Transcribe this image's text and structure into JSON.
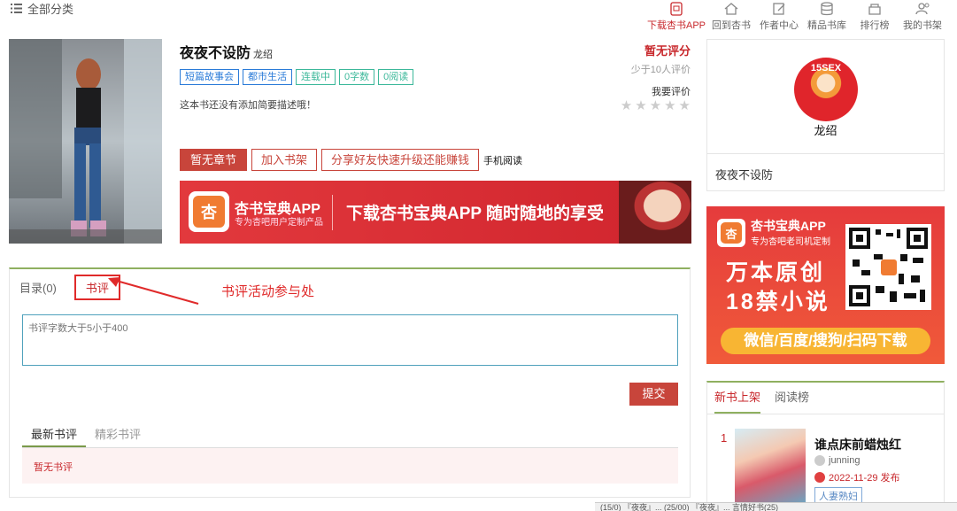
{
  "topbar": {
    "all_categories": "全部分类"
  },
  "nav": [
    {
      "label": "下载杏书APP",
      "icon": "phone-app-icon"
    },
    {
      "label": "回到杏书",
      "icon": "home-icon"
    },
    {
      "label": "作者中心",
      "icon": "edit-icon"
    },
    {
      "label": "精品书库",
      "icon": "database-icon"
    },
    {
      "label": "排行榜",
      "icon": "ranking-icon"
    },
    {
      "label": "我的书架",
      "icon": "user-icon"
    }
  ],
  "book": {
    "title": "夜夜不设防",
    "author": "龙绍",
    "tags": [
      "短篇故事会",
      "都市生活",
      "连载中",
      "0字数",
      "0阅读"
    ],
    "description": "这本书还没有添加简要描述哦！",
    "score": "暂无评分",
    "score_sub": "少于10人评价",
    "my_rate": "我要评价",
    "stars": [
      "★",
      "★",
      "★",
      "★",
      "★"
    ]
  },
  "actions": {
    "no_chapter": "暂无章节",
    "add_shelf": "加入书架",
    "share": "分享好友快速升级还能赚钱",
    "mobile_read": "手机阅读"
  },
  "banner": {
    "app_name": "杏书宝典APP",
    "app_sub": "专为杏吧用户定制产品",
    "slogan": "下载杏书宝典APP 随时随地的享受"
  },
  "tabs": {
    "directory": "目录(0)",
    "review": "书评"
  },
  "annotation": "书评活动参与处",
  "review_form": {
    "placeholder": "书评字数大于5小于400",
    "submit": "提交"
  },
  "review_tabs": [
    "最新书评",
    "精彩书评"
  ],
  "no_review": "暂无书评",
  "author_card": {
    "avatar_text": "15SEX",
    "name": "龙绍",
    "book": "夜夜不设防"
  },
  "side_banner": {
    "app_name": "杏书宝典APP",
    "app_sub": "专为杏吧老司机定制",
    "line1": "万本原创",
    "line2": "18禁小说",
    "bottom": "微信/百度/搜狗/扫码下载"
  },
  "rank": {
    "tabs": [
      "新书上架",
      "阅读榜"
    ],
    "item": {
      "num": "1",
      "title": "谁点床前蜡烛红",
      "user": "junning",
      "date": "2022-11-29 发布",
      "tag": "人妻熟妇"
    }
  },
  "bottom_bar": "(15/0) 『夜夜』...  (25/00) 『夜夜』...  言情好书(25)"
}
